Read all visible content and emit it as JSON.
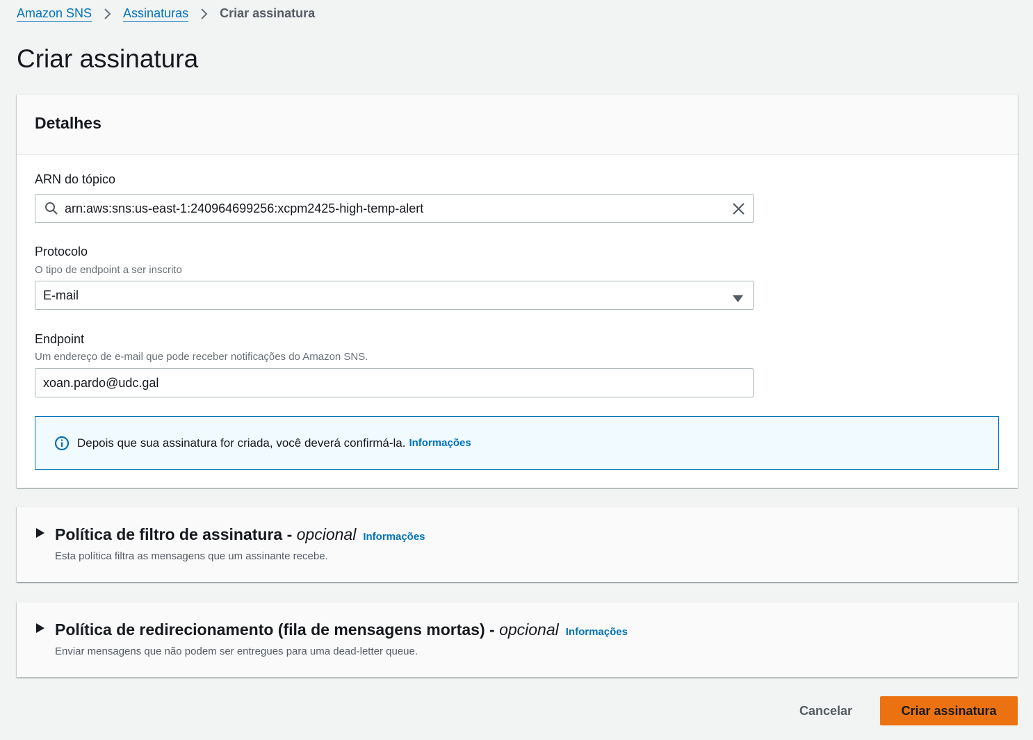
{
  "breadcrumb": {
    "items": [
      "Amazon SNS",
      "Assinaturas"
    ],
    "current": "Criar assinatura"
  },
  "page": {
    "title": "Criar assinatura"
  },
  "details": {
    "title": "Detalhes",
    "topic_arn": {
      "label": "ARN do tópico",
      "value": "arn:aws:sns:us-east-1:240964699256:xcpm2425-high-temp-alert"
    },
    "protocol": {
      "label": "Protocolo",
      "description": "O tipo de endpoint a ser inscrito",
      "selected": "E-mail"
    },
    "endpoint": {
      "label": "Endpoint",
      "description": "Um endereço de e-mail que pode receber notificações do Amazon SNS.",
      "value": "xoan.pardo@udc.gal"
    },
    "alert": {
      "text": "Depois que sua assinatura for criada, você deverá confirmá-la.",
      "link": "Informações"
    }
  },
  "filter_policy": {
    "title": "Política de filtro de assinatura - ",
    "optional": "opcional",
    "info": "Informações",
    "description": "Esta política filtra as mensagens que um assinante recebe."
  },
  "redrive_policy": {
    "title": "Política de redirecionamento (fila de mensagens mortas) - ",
    "optional": "opcional",
    "info": "Informações",
    "description": "Enviar mensagens que não podem ser entregues para uma dead-letter queue."
  },
  "footer": {
    "cancel": "Cancelar",
    "submit": "Criar assinatura"
  },
  "colors": {
    "link": "#0073bb",
    "primary_button": "#ec7211",
    "page_background": "#f2f3f3",
    "alert_background": "#f1faff"
  },
  "icons": [
    "chevron-right-icon",
    "search-icon",
    "close-icon",
    "caret-down-icon",
    "info-icon",
    "caret-right-icon"
  ]
}
